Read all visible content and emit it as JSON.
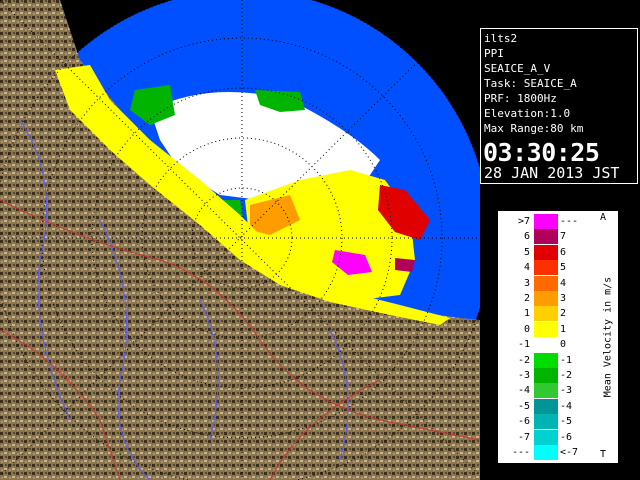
{
  "radar_info": {
    "station": "ilts2",
    "mode": "PPI",
    "scan": "SEAICE_A_V",
    "task": "Task: SEAICE_A",
    "prf": "PRF: 1800Hz",
    "elevation": "Elevation:1.0",
    "max_range": "Max Range:80 km",
    "time": "03:30:25",
    "date": "28 JAN 2013 JST"
  },
  "legend": {
    "title": "Mean Velocity in m/s",
    "top_letter": "A",
    "bottom_letter": "T",
    "rows": [
      {
        "left": ">7",
        "right": "---",
        "color": "#ff00ff"
      },
      {
        "left": "6",
        "right": "7",
        "color": "#b0005a"
      },
      {
        "left": "5",
        "right": "6",
        "color": "#e00000"
      },
      {
        "left": "4",
        "right": "5",
        "color": "#ff3000"
      },
      {
        "left": "3",
        "right": "4",
        "color": "#ff6a00"
      },
      {
        "left": "2",
        "right": "3",
        "color": "#ff9c00"
      },
      {
        "left": "1",
        "right": "2",
        "color": "#ffd000"
      },
      {
        "left": "0",
        "right": "1",
        "color": "#ffff00"
      },
      {
        "left": "-1",
        "right": "0",
        "color": "#ffffff"
      },
      {
        "left": "-2",
        "right": "-1",
        "color": "#00dc00"
      },
      {
        "left": "-3",
        "right": "-2",
        "color": "#00b400"
      },
      {
        "left": "-4",
        "right": "-3",
        "color": "#32c832"
      },
      {
        "left": "-5",
        "right": "-4",
        "color": "#009696"
      },
      {
        "left": "-6",
        "right": "-5",
        "color": "#00b4b4"
      },
      {
        "left": "-7",
        "right": "-6",
        "color": "#00d2d2"
      },
      {
        "left": "---",
        "right": "<-7",
        "color": "#00ffff"
      }
    ]
  },
  "colors": {
    "sea_coverage": "#0050ff",
    "land": "#7a6a4a",
    "background": "#000000"
  }
}
